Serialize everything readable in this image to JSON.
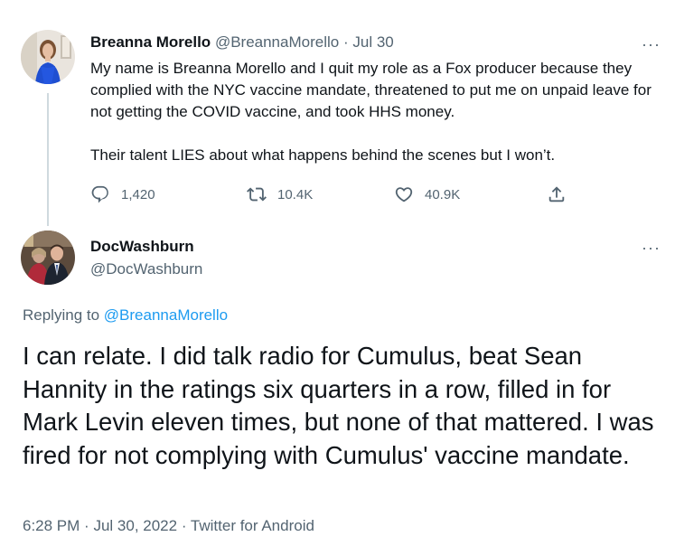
{
  "tweet1": {
    "name": "Breanna Morello",
    "handle": "@BreannaMorello",
    "separator": "·",
    "date": "Jul 30",
    "more": "···",
    "text_p1": "My name is Breanna Morello and I quit my role as a Fox producer because they complied with the NYC vaccine mandate, threatened to put me on unpaid leave for not getting the COVID vaccine, and took HHS money.",
    "text_p2": "Their talent LIES about what happens behind the scenes but I won’t.",
    "replies": "1,420",
    "retweets": "10.4K",
    "likes": "40.9K"
  },
  "tweet2": {
    "name": "DocWashburn",
    "handle": "@DocWashburn",
    "more": "···",
    "replying_prefix": "Replying to",
    "replying_mention": "@BreannaMorello",
    "text": "I can relate. I did talk radio for Cumulus, beat Sean Hannity in the ratings six quarters in a row, filled in for Mark Levin eleven times, but none of that mattered. I was fired for not complying with Cumulus' vaccine mandate.",
    "time": "6:28 PM",
    "separator": "·",
    "date": "Jul 30, 2022",
    "source": "Twitter for Android"
  },
  "colors": {
    "text": "#0f1419",
    "secondary": "#536471",
    "link": "#1d9bf0",
    "thread_line": "#cfd9de"
  },
  "icons": [
    "reply-icon",
    "retweet-icon",
    "like-icon",
    "share-icon",
    "more-icon"
  ]
}
